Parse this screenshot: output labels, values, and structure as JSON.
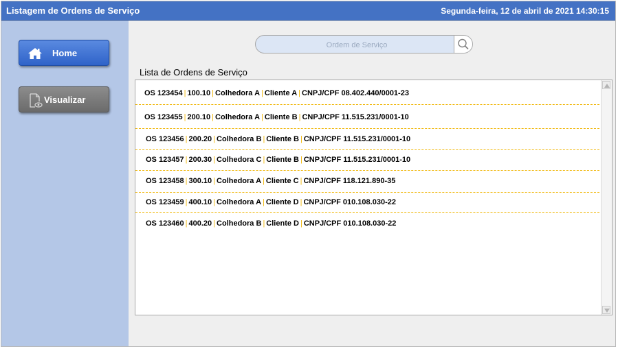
{
  "window": {
    "title": "Listagem de Ordens de Serviço",
    "datetime": "Segunda-feira, 12 de abril de 2021 14:30:15"
  },
  "sidebar": {
    "items": [
      {
        "label": "Home",
        "icon": "home-icon"
      },
      {
        "label": "Visualizar",
        "icon": "document-view-icon"
      }
    ]
  },
  "search": {
    "placeholder": "Ordem de Serviço",
    "icon": "search-icon"
  },
  "list": {
    "title": "Lista de Ordens de Serviço",
    "rows": [
      {
        "os": "OS 123454",
        "code": "100.10",
        "harvester": "Colhedora A",
        "client": "Cliente A",
        "doc": "CNPJ/CPF 08.402.440/0001-23"
      },
      {
        "os": "OS 123455",
        "code": "200.10",
        "harvester": "Colhedora A",
        "client": "Cliente B",
        "doc": "CNPJ/CPF 11.515.231/0001-10"
      },
      {
        "os": "OS 123456",
        "code": "200.20",
        "harvester": "Colhedora B",
        "client": "Cliente B",
        "doc": "CNPJ/CPF 11.515.231/0001-10"
      },
      {
        "os": "OS 123457",
        "code": "200.30",
        "harvester": "Colhedora C",
        "client": "Cliente B",
        "doc": "CNPJ/CPF 11.515.231/0001-10"
      },
      {
        "os": "OS 123458",
        "code": "300.10",
        "harvester": "Colhedora A",
        "client": "Cliente C",
        "doc": "CNPJ/CPF 118.121.890-35"
      },
      {
        "os": "OS 123459",
        "code": "400.10",
        "harvester": "Colhedora A",
        "client": "Cliente D",
        "doc": "CNPJ/CPF 010.108.030-22"
      },
      {
        "os": "OS 123460",
        "code": "400.20",
        "harvester": "Colhedora B",
        "client": "Cliente D",
        "doc": "CNPJ/CPF 010.108.030-22"
      }
    ]
  },
  "colors": {
    "titlebar": "#4472c4",
    "sidebar": "#b4c7e7",
    "separator": "#f0b400",
    "home_button": "#2f63c9",
    "view_button": "#7a7a7a"
  }
}
